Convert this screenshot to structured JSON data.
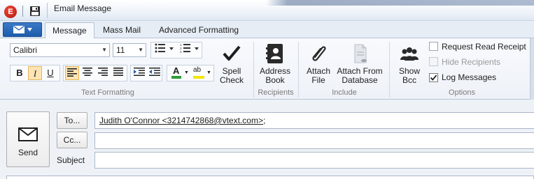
{
  "window": {
    "title": "Email Message",
    "app_logo_letter": "E"
  },
  "tabs": [
    {
      "label": "Message",
      "active": true
    },
    {
      "label": "Mass Mail",
      "active": false
    },
    {
      "label": "Advanced Formatting",
      "active": false
    }
  ],
  "ribbon": {
    "text_formatting": {
      "font_family": "Calibri",
      "font_size": "11",
      "bold": "B",
      "italic": "I",
      "underline": "U",
      "italic_active": true,
      "align_left_active": true,
      "font_color": "#2e9c3a",
      "highlight_color": "#f2e600",
      "font_color_glyph": "A",
      "highlight_glyph": "ab",
      "group_label": "Text Formatting"
    },
    "spell_check": {
      "label_line1": "Spell",
      "label_line2": "Check"
    },
    "recipients": {
      "address_book": {
        "line1": "Address",
        "line2": "Book"
      },
      "group_label": "Recipients"
    },
    "include": {
      "attach_file": {
        "line1": "Attach",
        "line2": "File"
      },
      "attach_db": {
        "line1": "Attach From",
        "line2": "Database"
      },
      "group_label": "Include"
    },
    "options": {
      "show_bcc": {
        "line1": "Show",
        "line2": "Bcc"
      },
      "request_read_receipt": {
        "label": "Request Read Receipt",
        "checked": false,
        "enabled": true
      },
      "hide_recipients": {
        "label": "Hide Recipients",
        "checked": false,
        "enabled": false
      },
      "log_messages": {
        "label": "Log Messages",
        "checked": true,
        "enabled": true
      },
      "group_label": "Options"
    }
  },
  "compose": {
    "send_label": "Send",
    "to_button": "To...",
    "cc_button": "Cc...",
    "subject_label": "Subject",
    "to_value": "Judith O'Connor <3214742868@vtext.com>",
    "to_separator": ";",
    "cc_value": "",
    "subject_value": ""
  },
  "colors": {
    "accent_blue": "#1d5cac",
    "toggle_highlight": "#fce4b4"
  }
}
